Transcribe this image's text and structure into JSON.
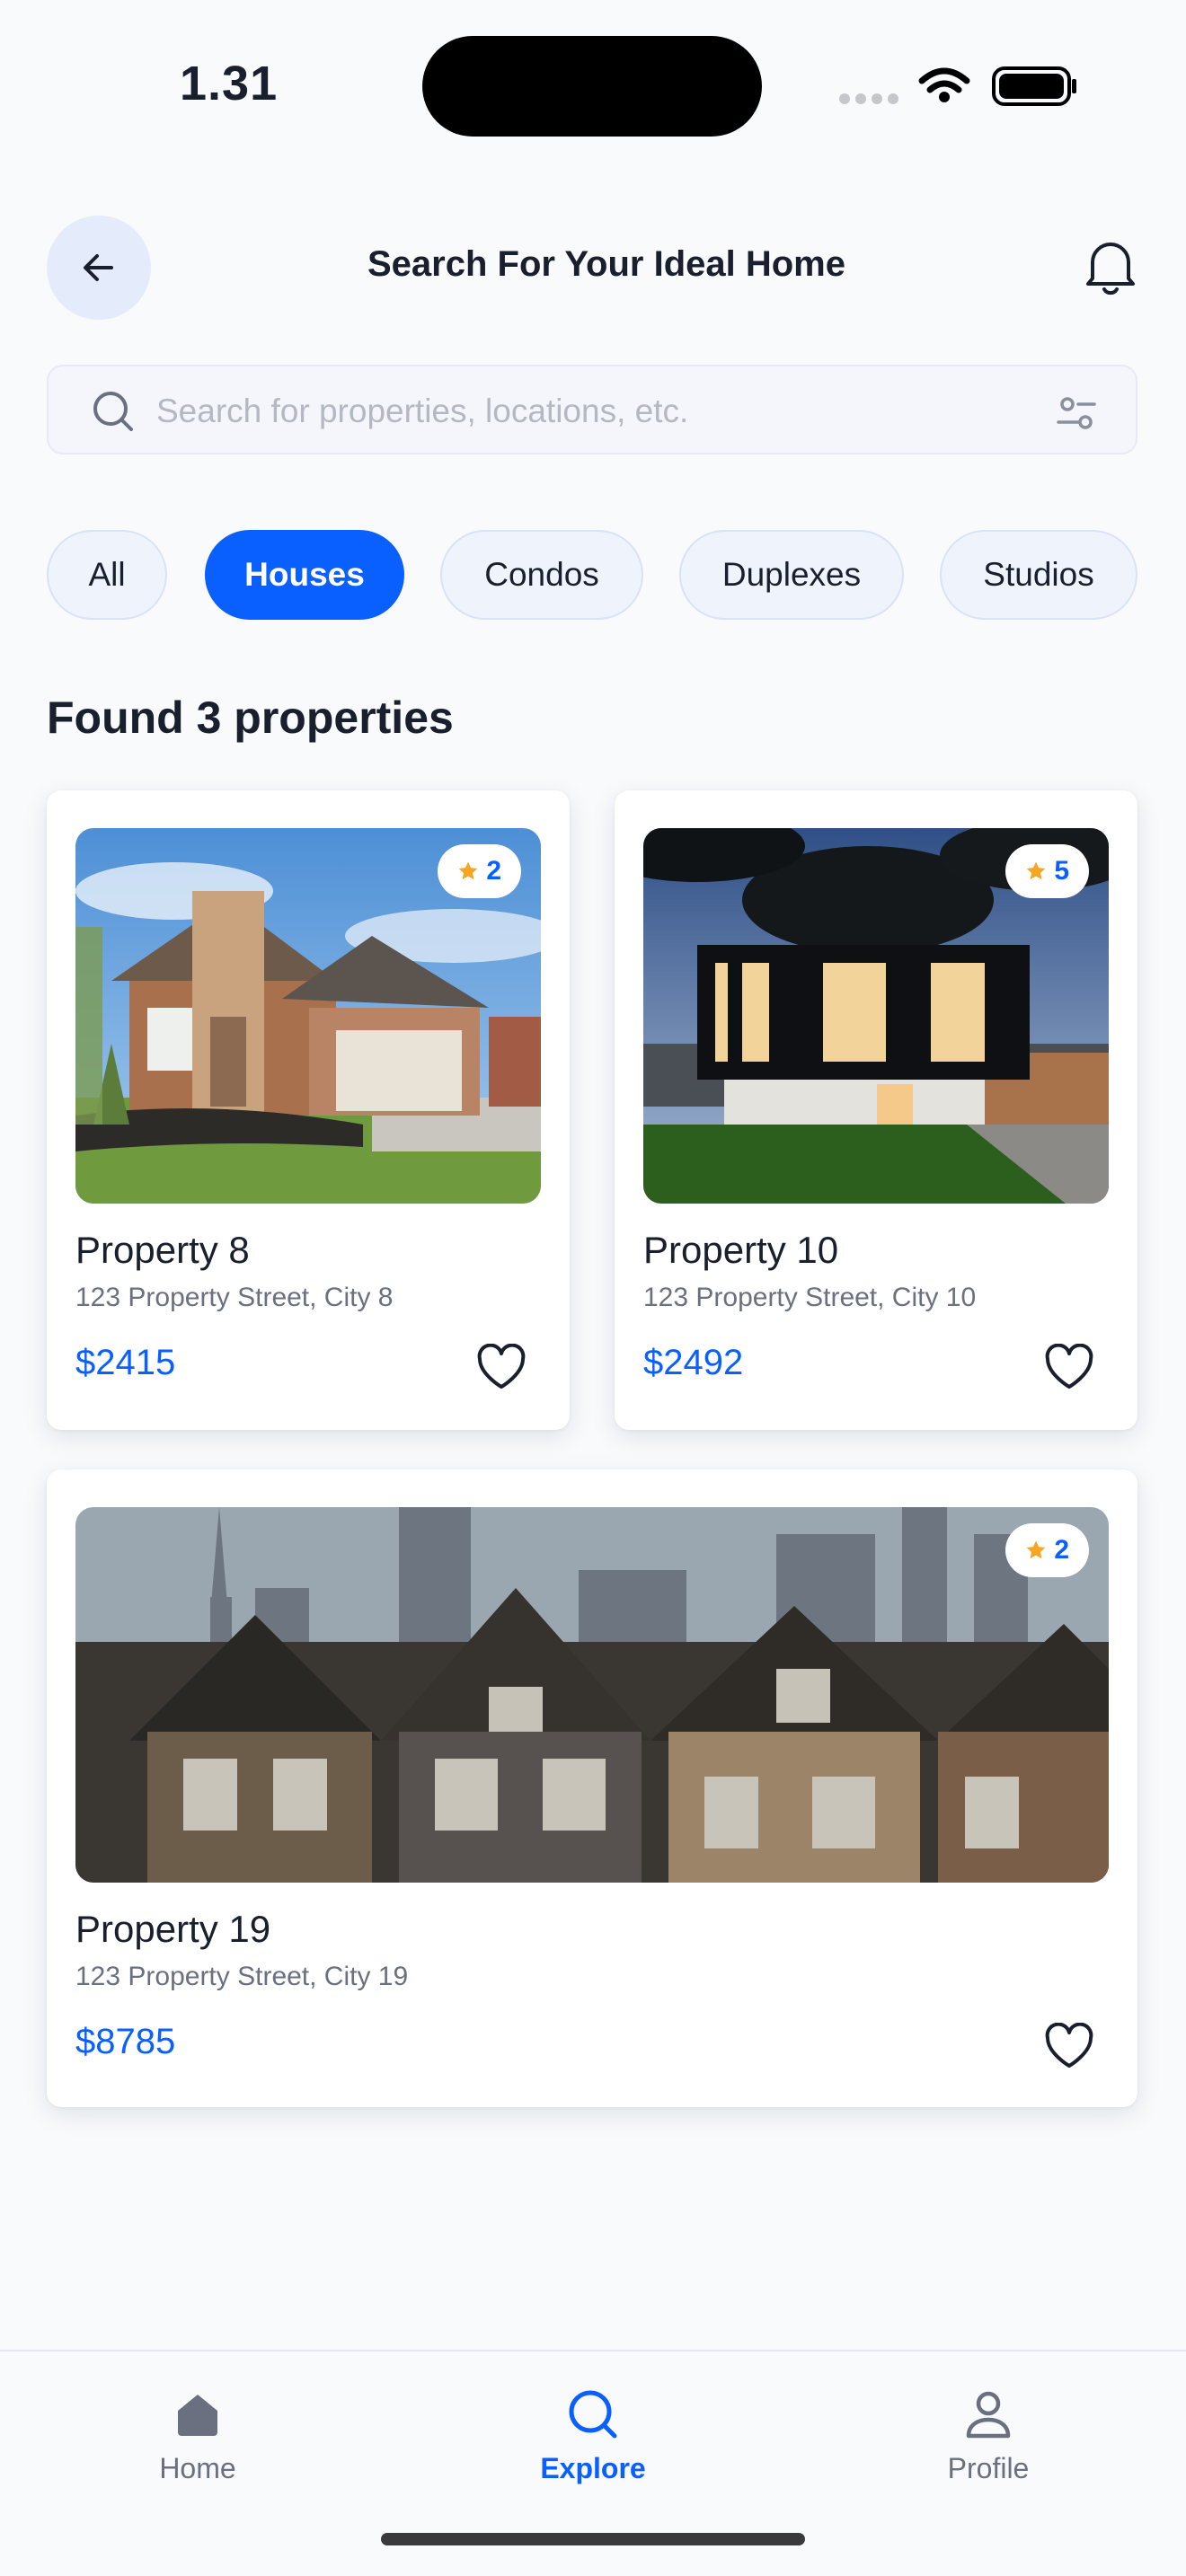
{
  "status_bar": {
    "time": "1.31"
  },
  "header": {
    "title": "Search For Your Ideal Home",
    "back_icon": "arrow-left-icon",
    "bell_icon": "bell-icon"
  },
  "search": {
    "placeholder": "Search for properties, locations, etc.",
    "value": "",
    "filter_icon": "sliders-icon"
  },
  "filters": [
    {
      "label": "All",
      "selected": false
    },
    {
      "label": "Houses",
      "selected": true
    },
    {
      "label": "Condos",
      "selected": false
    },
    {
      "label": "Duplexes",
      "selected": false
    },
    {
      "label": "Studios",
      "selected": false
    }
  ],
  "results": {
    "heading": "Found 3 properties",
    "properties": [
      {
        "name": "Property 8",
        "address": "123 Property Street, City 8",
        "price": "$2415",
        "rating": "2"
      },
      {
        "name": "Property 10",
        "address": "123 Property Street, City 10",
        "price": "$2492",
        "rating": "5"
      },
      {
        "name": "Property 19",
        "address": "123 Property Street, City 19",
        "price": "$8785",
        "rating": "2"
      }
    ]
  },
  "bottom_nav": [
    {
      "label": "Home",
      "icon": "home-icon",
      "active": false
    },
    {
      "label": "Explore",
      "icon": "search-icon",
      "active": true
    },
    {
      "label": "Profile",
      "icon": "user-icon",
      "active": false
    }
  ],
  "colors": {
    "accent": "#0a60ff",
    "star": "#f5a623",
    "text": "#1a1f2e",
    "muted": "#6b7080"
  }
}
